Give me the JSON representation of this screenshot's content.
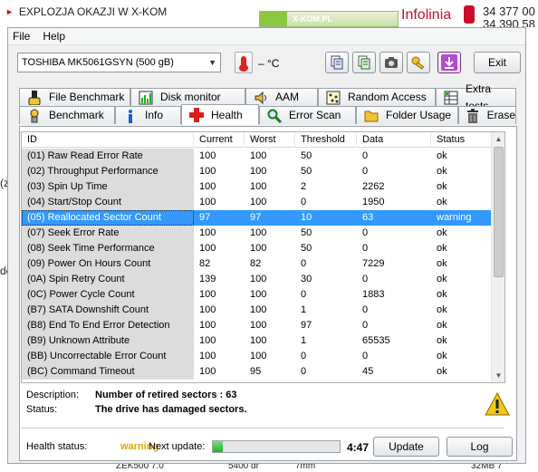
{
  "background": {
    "promo_text": "EXPLOZJA OKAZJI W X-KOM",
    "banner_text": "X-KOM.PL",
    "infolinia": "Infolinia",
    "phone_1": "34 377 00",
    "phone_2": "34 390 58",
    "left_fragments": [
      "(z",
      "de"
    ],
    "bottom_fragments": [
      "ZEK500 7.0",
      "5400 dr",
      "7mm",
      "32MB 7"
    ]
  },
  "menu": {
    "file": "File",
    "help": "Help"
  },
  "toolbar": {
    "drive": "TOSHIBA MK5061GSYN (500 gB)",
    "temperature": "– °C",
    "exit_label": "Exit",
    "icons": [
      "copy-icon",
      "copy-all-icon",
      "camera-icon",
      "key-icon",
      "download-icon"
    ]
  },
  "tabs_top": [
    "File Benchmark",
    "Disk monitor",
    "AAM",
    "Random Access",
    "Extra tests"
  ],
  "tabs_bottom": [
    "Benchmark",
    "Info",
    "Health",
    "Error Scan",
    "Folder Usage",
    "Erase"
  ],
  "active_tab": "Health",
  "smart": {
    "columns": [
      "ID",
      "Current",
      "Worst",
      "Threshold",
      "Data",
      "Status"
    ],
    "selected_row": 4,
    "rows": [
      [
        "(01) Raw Read Error Rate",
        "100",
        "100",
        "50",
        "0",
        "ok"
      ],
      [
        "(02) Throughput Performance",
        "100",
        "100",
        "50",
        "0",
        "ok"
      ],
      [
        "(03) Spin Up Time",
        "100",
        "100",
        "2",
        "2262",
        "ok"
      ],
      [
        "(04) Start/Stop Count",
        "100",
        "100",
        "0",
        "1950",
        "ok"
      ],
      [
        "(05) Reallocated Sector Count",
        "97",
        "97",
        "10",
        "63",
        "warning"
      ],
      [
        "(07) Seek Error Rate",
        "100",
        "100",
        "50",
        "0",
        "ok"
      ],
      [
        "(08) Seek Time Performance",
        "100",
        "100",
        "50",
        "0",
        "ok"
      ],
      [
        "(09) Power On Hours Count",
        "82",
        "82",
        "0",
        "7229",
        "ok"
      ],
      [
        "(0A) Spin Retry Count",
        "139",
        "100",
        "30",
        "0",
        "ok"
      ],
      [
        "(0C) Power Cycle Count",
        "100",
        "100",
        "0",
        "1883",
        "ok"
      ],
      [
        "(B7) SATA Downshift Count",
        "100",
        "100",
        "1",
        "0",
        "ok"
      ],
      [
        "(B8) End To End Error Detection",
        "100",
        "100",
        "97",
        "0",
        "ok"
      ],
      [
        "(B9) Unknown Attribute",
        "100",
        "100",
        "1",
        "65535",
        "ok"
      ],
      [
        "(BB) Uncorrectable Error Count",
        "100",
        "100",
        "0",
        "0",
        "ok"
      ],
      [
        "(BC) Command Timeout",
        "100",
        "95",
        "0",
        "45",
        "ok"
      ]
    ]
  },
  "description": {
    "label": "Description:",
    "value": "Number of retired sectors : 63",
    "status_label": "Status:",
    "status_value": "The drive has damaged sectors."
  },
  "footer": {
    "health_label": "Health status:",
    "health_value": "warning",
    "next_update_label": "Next update:",
    "progress": 0.08,
    "countdown": "4:47",
    "update_label": "Update",
    "log_label": "Log"
  },
  "colors": {
    "selection": "#3399ff",
    "warning": "#e8a400",
    "progress": "#20b020"
  }
}
